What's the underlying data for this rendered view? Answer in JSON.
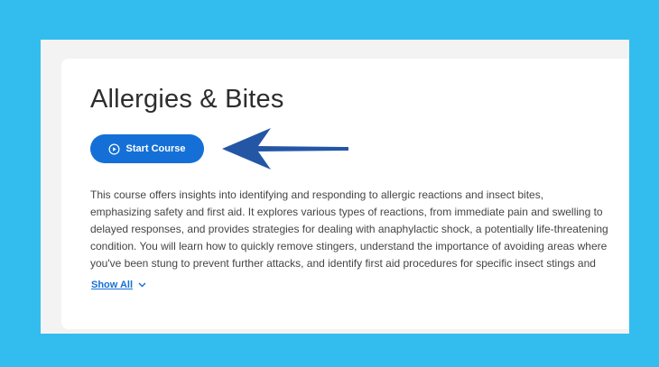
{
  "course": {
    "title": "Allergies & Bites",
    "start_label": "Start Course",
    "description_lines": [
      "This course offers insights into identifying and responding to allergic reactions and insect bites,",
      "emphasizing safety and first aid. It explores various types of reactions, from immediate pain and swelling to",
      "delayed responses, and provides strategies for dealing with anaphylactic shock, a potentially life-threatening",
      "condition. You will learn how to quickly remove stingers, understand the importance of avoiding areas where",
      "you've been stung to prevent further attacks, and identify first aid procedures for specific insect stings and"
    ],
    "show_all_label": "Show All"
  },
  "icons": {
    "play": "play-circle-icon",
    "chevron": "chevron-down-icon"
  },
  "colors": {
    "background": "#32bdee",
    "primary": "#1470d6",
    "arrow": "#2456a6"
  }
}
